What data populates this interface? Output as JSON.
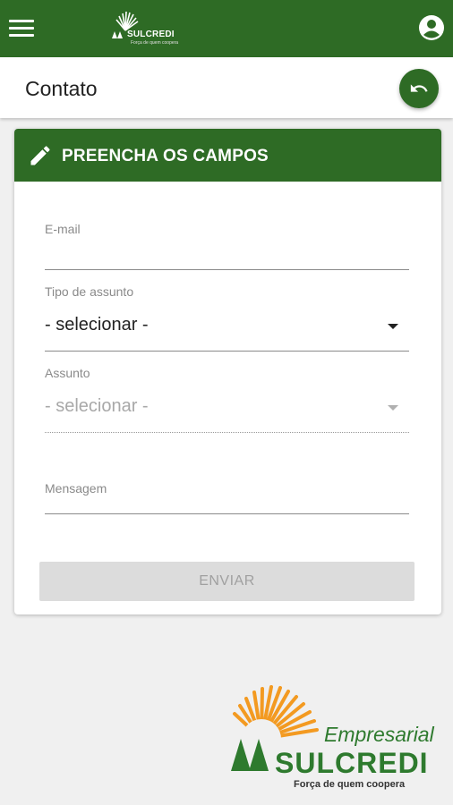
{
  "app": {
    "brand": "SULCREDI",
    "brand_tagline": "Força de quem coopera"
  },
  "header": {
    "title": "Contato"
  },
  "form": {
    "title": "PREENCHA OS CAMPOS",
    "email_label": "E-mail",
    "email_value": "",
    "tipo_label": "Tipo de assunto",
    "tipo_value": "- selecionar -",
    "assunto_label": "Assunto",
    "assunto_value": "- selecionar -",
    "mensagem_label": "Mensagem",
    "mensagem_value": "",
    "submit_label": "ENVIAR"
  },
  "footer_logo": {
    "line1": "Empresarial",
    "line2": "SULCREDI",
    "slogan": "Força de quem coopera"
  },
  "colors": {
    "primary": "#2e6b25",
    "orange": "#f39a21",
    "disabled": "#dcdcdc"
  }
}
